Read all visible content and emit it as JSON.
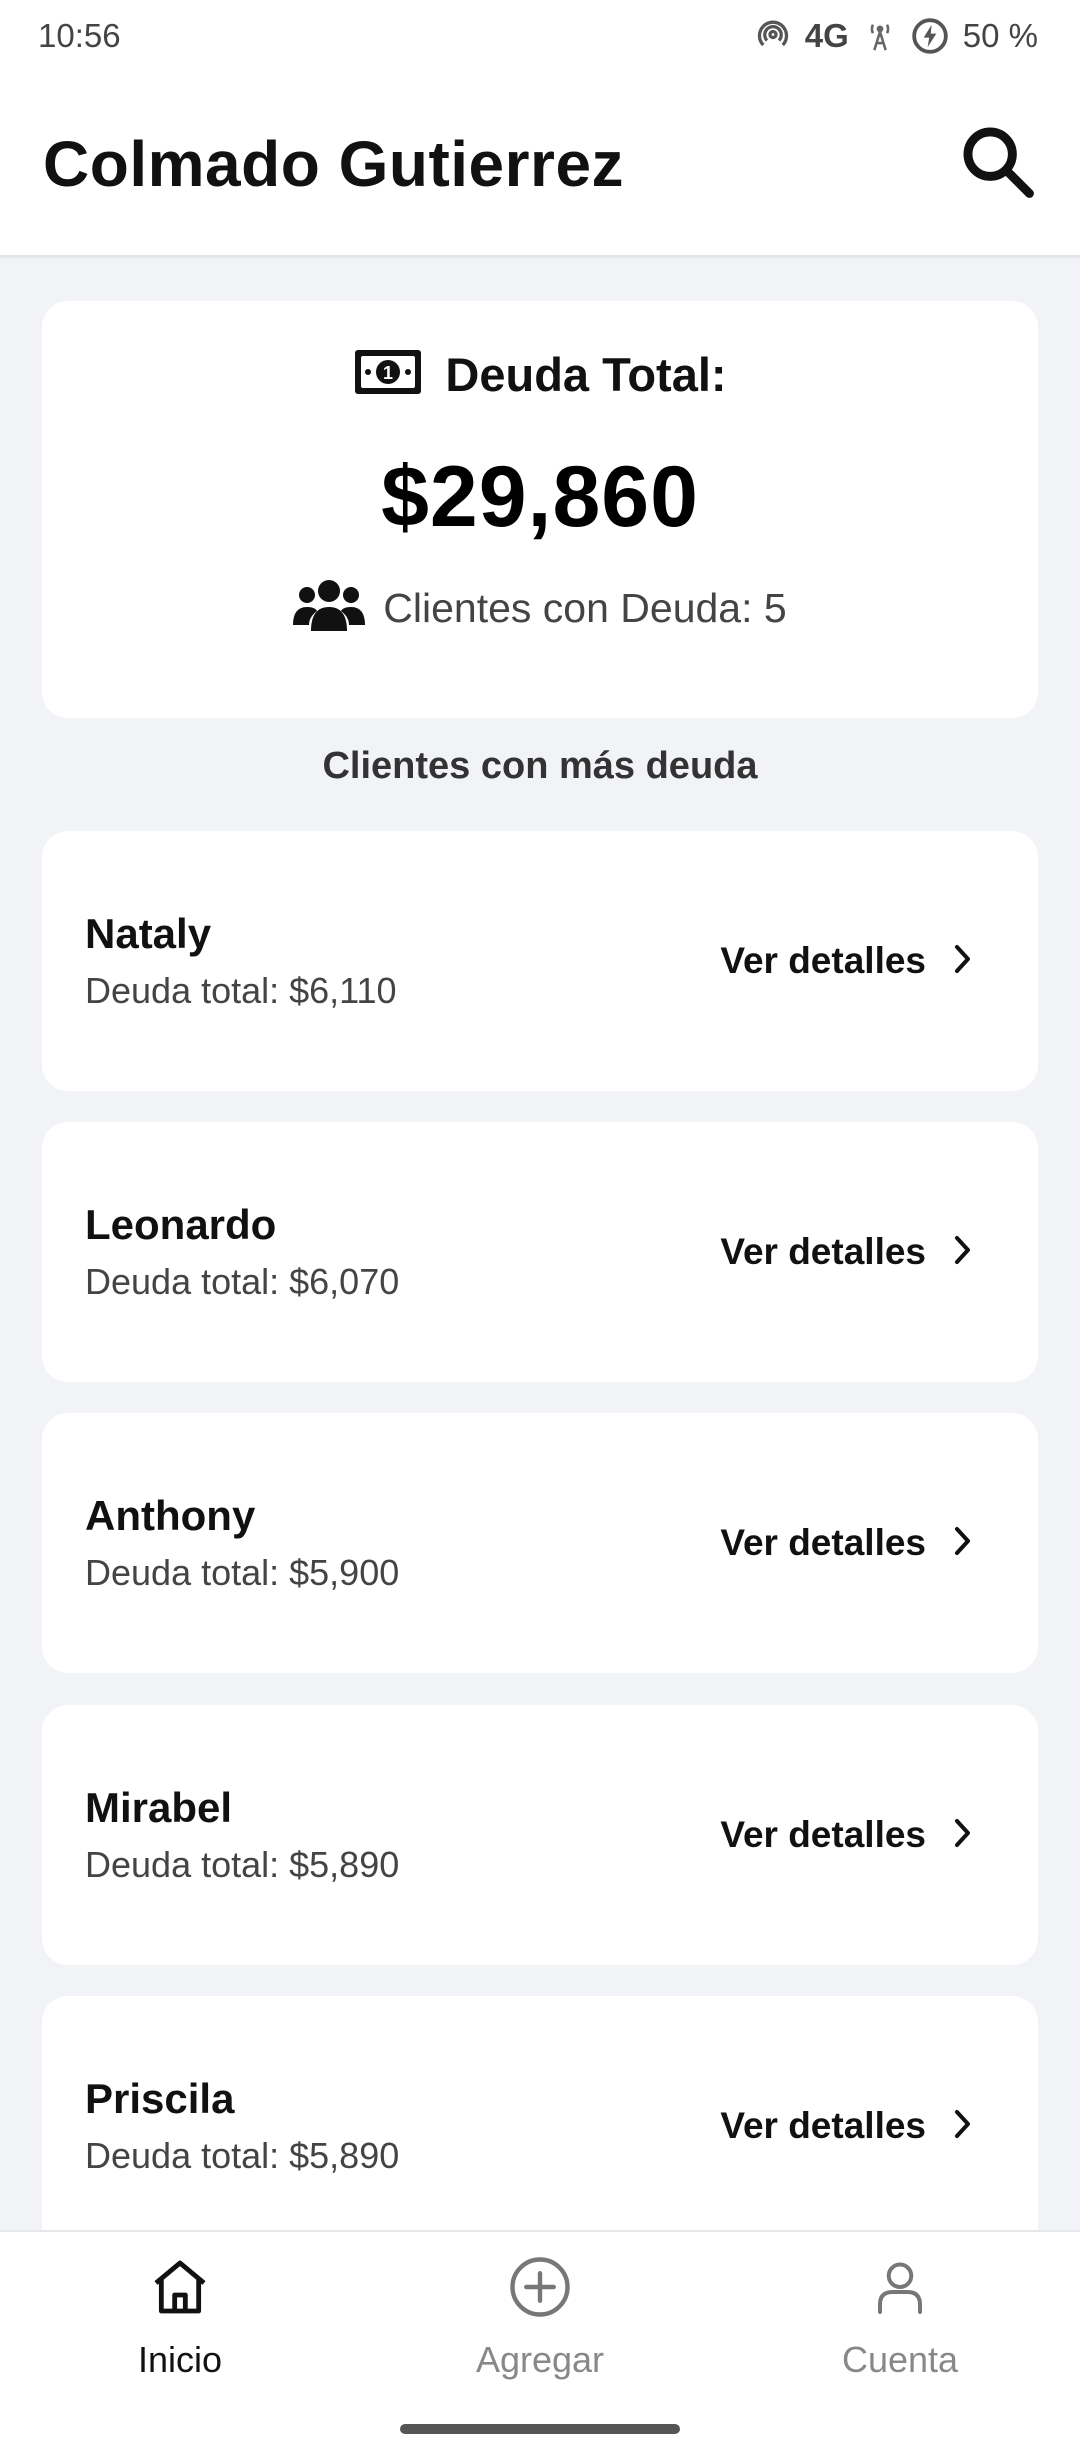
{
  "status_bar": {
    "time": "10:56",
    "network": "4G",
    "battery": "50 %",
    "icons": [
      "hotspot-icon",
      "signal-tower-icon",
      "battery-saver-icon"
    ]
  },
  "header": {
    "title": "Colmado Gutierrez",
    "search_icon": "search-icon"
  },
  "summary": {
    "title_icon": "money-bill-icon",
    "title": "Deuda Total:",
    "amount": "$29,860",
    "clients_icon": "users-icon",
    "clients_text": "Clientes con Deuda: 5"
  },
  "section_title": "Clientes con más deuda",
  "clients": [
    {
      "name": "Nataly",
      "debt": "Deuda total: $6,110",
      "action": "Ver detalles"
    },
    {
      "name": "Leonardo",
      "debt": "Deuda total: $6,070",
      "action": "Ver detalles"
    },
    {
      "name": "Anthony",
      "debt": "Deuda total: $5,900",
      "action": "Ver detalles"
    },
    {
      "name": "Mirabel",
      "debt": "Deuda total: $5,890",
      "action": "Ver detalles"
    },
    {
      "name": "Priscila",
      "debt": "Deuda total: $5,890",
      "action": "Ver detalles"
    }
  ],
  "nav": [
    {
      "label": "Inicio",
      "icon": "home-icon",
      "active": true
    },
    {
      "label": "Agregar",
      "icon": "plus-circle-icon",
      "active": false
    },
    {
      "label": "Cuenta",
      "icon": "person-icon",
      "active": false
    }
  ],
  "colors": {
    "background": "#f2f3f7",
    "card": "#ffffff",
    "text_primary": "#111111",
    "text_secondary": "#444444",
    "nav_inactive": "#888888"
  }
}
